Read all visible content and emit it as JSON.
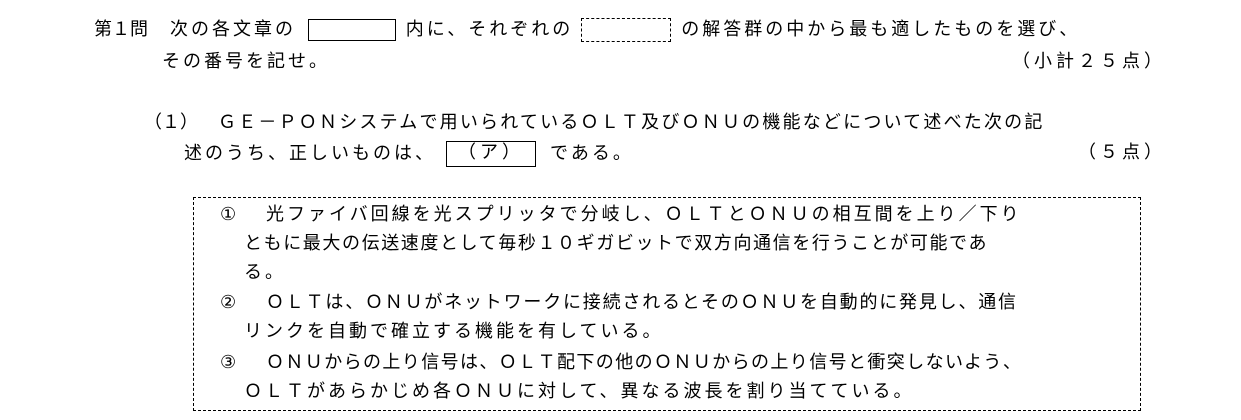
{
  "header": {
    "q_num": "第１問",
    "text1": "次の各文章の",
    "text2": "内に、それぞれの",
    "text3": "の解答群の中から最も適したものを選び、",
    "text4": "その番号を記せ。",
    "total_points": "（小計２５点）"
  },
  "question": {
    "number": "（１）",
    "line1": "ＧＥ－ＰＯＮシステムで用いられているＯＬＴ及びＯＮＵの機能などについて述べた次の記",
    "line2_a": "述のうち、正しいものは、",
    "answer_label": "（ア）",
    "line2_b": "である。",
    "points": "（５点）"
  },
  "choices": [
    {
      "mark": "①",
      "lines": [
        "光ファイバ回線を光スプリッタで分岐し、ＯＬＴとＯＮＵの相互間を上り／下り",
        "ともに最大の伝送速度として毎秒１０ギガビットで双方向通信を行うことが可能であ",
        "る。"
      ]
    },
    {
      "mark": "②",
      "lines": [
        "ＯＬＴは、ＯＮＵがネットワークに接続されるとそのＯＮＵを自動的に発見し、通信",
        "リンクを自動で確立する機能を有している。"
      ]
    },
    {
      "mark": "③",
      "lines": [
        "ＯＮＵからの上り信号は、ＯＬＴ配下の他のＯＮＵからの上り信号と衝突しないよう、",
        "ＯＬＴがあらかじめ各ＯＮＵに対して、異なる波長を割り当てている。"
      ]
    }
  ]
}
